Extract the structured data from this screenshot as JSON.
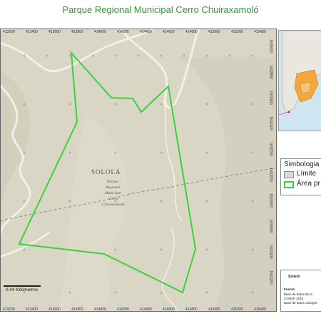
{
  "title": "Parque Regional Municipal Cerro Chuiraxamoló",
  "map": {
    "x_ticks": [
      "413200",
      "413400",
      "413600",
      "413800",
      "414000",
      "414200",
      "414400",
      "414600",
      "414800",
      "415000",
      "415200",
      "415400"
    ],
    "y_ticks": [
      "1633000",
      "1632800",
      "1632600",
      "1632400",
      "1632200",
      "1632000",
      "1631800",
      "1631600",
      "1631400",
      "1631200"
    ],
    "labels": {
      "municipality": "SOLOLA",
      "park_line1": "Parque",
      "park_line2": "Regional",
      "park_line3": "Municipal",
      "park_line4": "Cerro",
      "park_line5": "Chuiraxamoló"
    },
    "scale_label": "0.44 Kilómetros",
    "colors": {
      "park_outline": "#3ad23a",
      "terrain": "#dad6c5"
    }
  },
  "legend": {
    "title": "Simbologia",
    "items": [
      {
        "label": "Límite"
      },
      {
        "label": "Área pr"
      }
    ]
  },
  "sources": {
    "header": "Sistem",
    "line1": "Fuente:",
    "line2": "Base de datos de la",
    "line3": "CONAP 2016",
    "line4": "Base de datos cartogra"
  }
}
